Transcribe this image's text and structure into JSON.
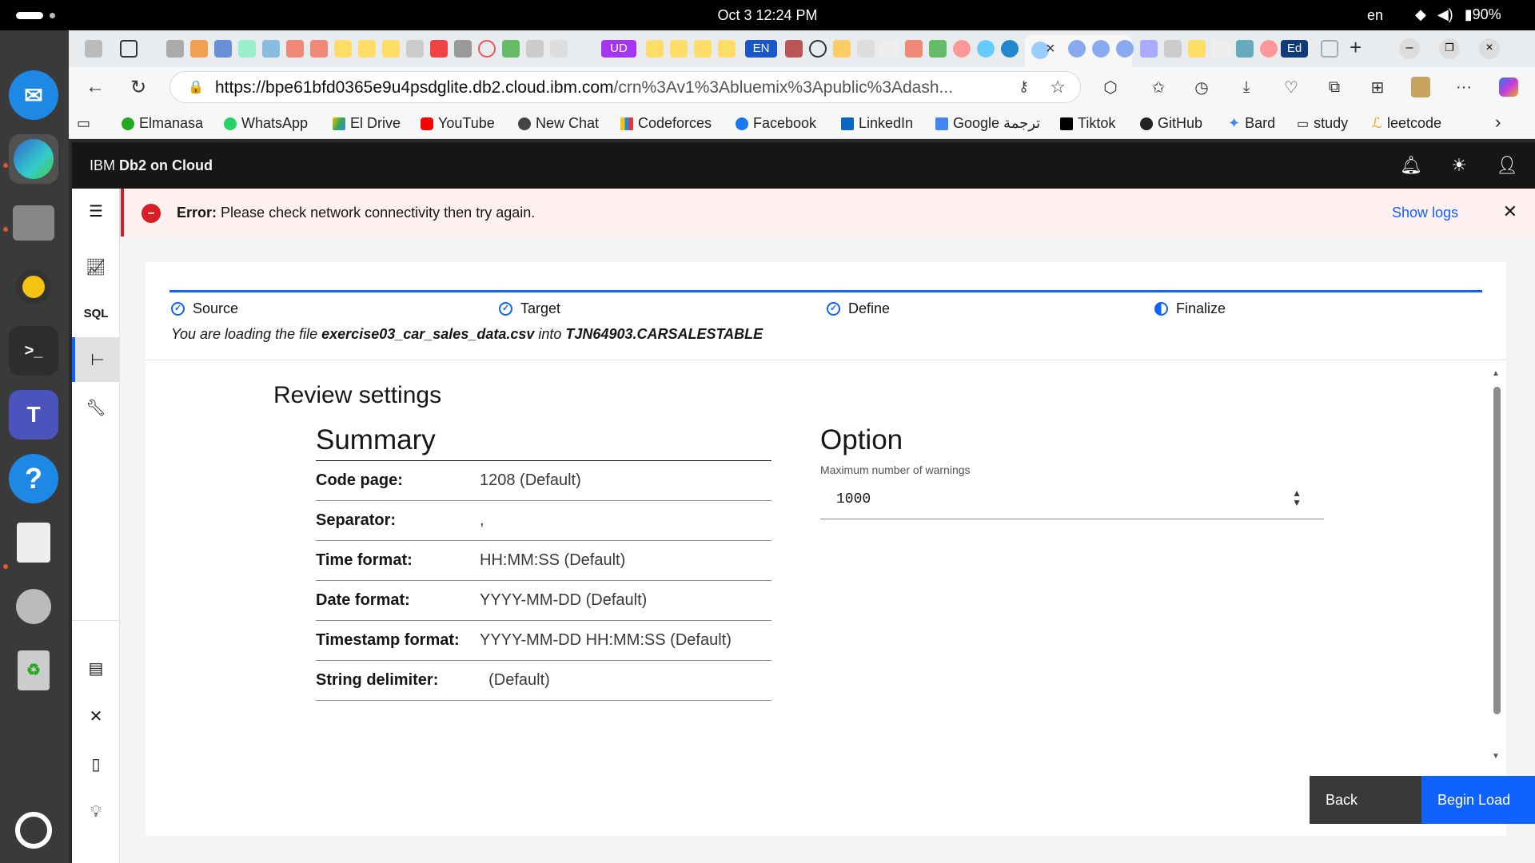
{
  "os": {
    "clock": "Oct 3  12:24 PM",
    "lang": "en",
    "battery": "90%"
  },
  "browser": {
    "url_host": "https://bpe61bfd0365e9u4psdglite.db2.cloud.ibm.com",
    "url_path": "/crn%3Av1%3Abluemix%3Apublic%3Adash...",
    "bookmarks": [
      "Elmanasa",
      "WhatsApp",
      "El Drive",
      "YouTube",
      "New Chat",
      "Codeforces",
      "Facebook",
      "LinkedIn",
      "Google ترجمة",
      "Tiktok",
      "GitHub",
      "Bard",
      "study",
      "leetcode"
    ],
    "tab_badges": [
      "UD",
      "EN",
      "Ed"
    ]
  },
  "app": {
    "brand_prefix": "IBM ",
    "brand_name": "Db2 on Cloud"
  },
  "error": {
    "label": "Error:",
    "message": "Please check network connectivity then try again.",
    "show_logs": "Show logs"
  },
  "nav": {
    "sql_label": "SQL"
  },
  "wizard": {
    "steps": [
      "Source",
      "Target",
      "Define",
      "Finalize"
    ],
    "load_prefix": "You are loading the file ",
    "file_name": "exercise03_car_sales_data.csv",
    "load_middle": " into ",
    "table_name": "TJN64903.CARSALESTABLE"
  },
  "review": {
    "title": "Review settings",
    "summary_title": "Summary",
    "rows": [
      {
        "key": "Code page:",
        "value": "1208  (Default)"
      },
      {
        "key": "Separator:",
        "value": ","
      },
      {
        "key": "Time format:",
        "value": "HH:MM:SS  (Default)"
      },
      {
        "key": "Date format:",
        "value": "YYYY-MM-DD  (Default)"
      },
      {
        "key": "Timestamp format:",
        "value": "YYYY-MM-DD HH:MM:SS  (Default)"
      },
      {
        "key": "String delimiter:",
        "value": "  (Default)"
      }
    ],
    "option_title": "Option",
    "option_label": "Maximum number of warnings",
    "max_warnings": "1000"
  },
  "buttons": {
    "back": "Back",
    "begin_load": "Begin Load"
  },
  "colors": {
    "accent": "#0f62fe",
    "error": "#da1e28",
    "error_bg": "#fff1f1",
    "header_bg": "#161616"
  }
}
